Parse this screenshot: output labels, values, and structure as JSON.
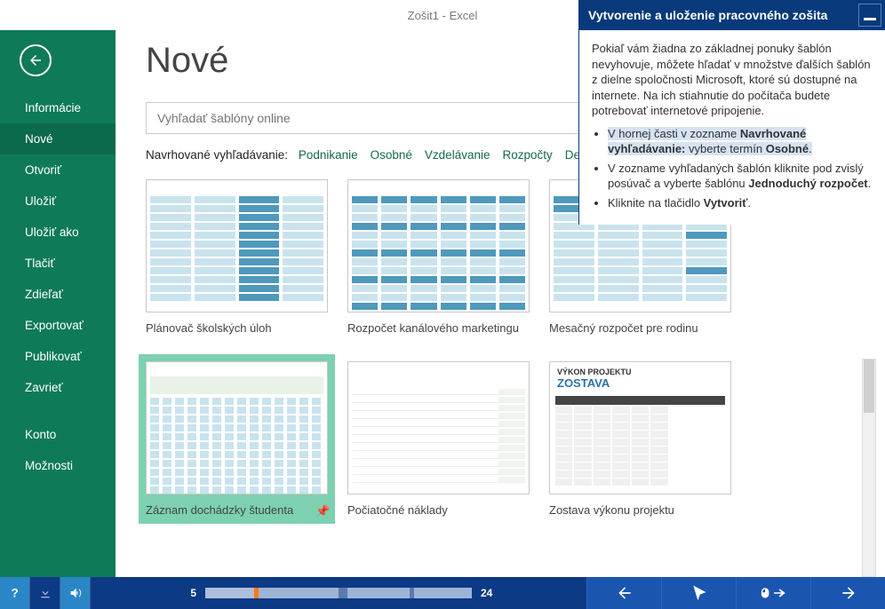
{
  "titlebar": {
    "title": "Zošit1 - Excel"
  },
  "help": {
    "title": "Vytvorenie a uloženie pracovného zošita",
    "paragraph": "Pokiaľ vám žiadna zo základnej ponuky šablón nevyhovuje, môžete hľadať v množstve ďalších šablón z dielne spoločnosti Microsoft, ktoré sú dostupné na internete. Na ich stiahnutie do počítača budete potrebovať internetové pripojenie.",
    "bullets": [
      {
        "pre": "V hornej časti v zozname ",
        "b1": "Navrhované vyhľadávanie:",
        "mid": " vyberte termín ",
        "b2": "Osobné",
        "post": ".",
        "highlight": true
      },
      {
        "pre": "V zozname vyhľadaných šablón kliknite pod zvislý posúvač a vyberte šablónu ",
        "b1": "Jednoduchý rozpočet",
        "mid": "",
        "b2": "",
        "post": ".",
        "highlight": false
      },
      {
        "pre": "Kliknite na tlačidlo ",
        "b1": "Vytvoriť",
        "mid": "",
        "b2": "",
        "post": ".",
        "highlight": false
      }
    ]
  },
  "sidebar": {
    "items": [
      {
        "id": "informacie",
        "label": "Informácie"
      },
      {
        "id": "nove",
        "label": "Nové",
        "selected": true
      },
      {
        "id": "otvorit",
        "label": "Otvoriť"
      },
      {
        "id": "ulozit",
        "label": "Uložiť"
      },
      {
        "id": "ulozitako",
        "label": "Uložiť ako"
      },
      {
        "id": "tlacit",
        "label": "Tlačiť"
      },
      {
        "id": "zdielat",
        "label": "Zdieľať"
      },
      {
        "id": "exportovat",
        "label": "Exportovať"
      },
      {
        "id": "publikovat",
        "label": "Publikovať"
      },
      {
        "id": "zavriet",
        "label": "Zavrieť"
      }
    ],
    "footer_items": [
      {
        "id": "konto",
        "label": "Konto"
      },
      {
        "id": "moznosti",
        "label": "Možnosti"
      }
    ]
  },
  "main": {
    "heading": "Nové",
    "search_placeholder": "Vyhľadať šablóny online",
    "suggested_label": "Navrhované vyhľadávanie:",
    "suggested": [
      "Podnikanie",
      "Osobné",
      "Vzdelávanie",
      "Rozpočty",
      "Denní..."
    ],
    "templates_row1": [
      {
        "id": "planovac",
        "label": "Plánovač školských úloh",
        "style": "table-blue"
      },
      {
        "id": "marketing",
        "label": "Rozpočet kanálového marketingu",
        "style": "numbers-blue"
      },
      {
        "id": "mesacny",
        "label": "Mesačný rozpočet pre rodinu",
        "style": "family-budget"
      }
    ],
    "templates_row2": [
      {
        "id": "dochadzka",
        "label": "Záznam dochádzky študenta",
        "style": "attendance",
        "selected": true
      },
      {
        "id": "naklady",
        "label": "Počiatočné náklady",
        "style": "startup-costs"
      },
      {
        "id": "zostava",
        "label": "Zostava výkonu projektu",
        "style": "project-report"
      }
    ]
  },
  "bottombar": {
    "current": "5",
    "total": "24"
  }
}
